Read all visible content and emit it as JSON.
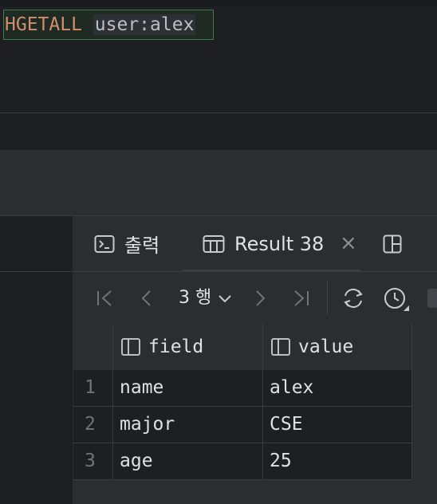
{
  "editor": {
    "query_keyword": "HGETALL",
    "query_arg": "user:alex"
  },
  "tabs": [
    {
      "label": "출력",
      "icon": "console-icon"
    },
    {
      "label": "Result 38",
      "icon": "table-icon",
      "active": true
    }
  ],
  "tab_close_glyph": "×",
  "toolbar": {
    "rows_label": "3 행",
    "icons": [
      "first-page-icon",
      "prev-page-icon",
      "next-page-icon",
      "last-page-icon",
      "refresh-icon",
      "history-icon"
    ]
  },
  "table": {
    "columns": [
      "field",
      "value"
    ],
    "rows": [
      {
        "num": "1",
        "field": "name",
        "value": "alex"
      },
      {
        "num": "2",
        "field": "major",
        "value": "CSE"
      },
      {
        "num": "3",
        "field": "age",
        "value": "25"
      }
    ]
  },
  "colors": {
    "keyword": "#cf8e6d",
    "text": "#dfe1e5",
    "panel": "#2b2d30",
    "editor": "#1e1f22",
    "query_border": "#3f7a4a"
  }
}
